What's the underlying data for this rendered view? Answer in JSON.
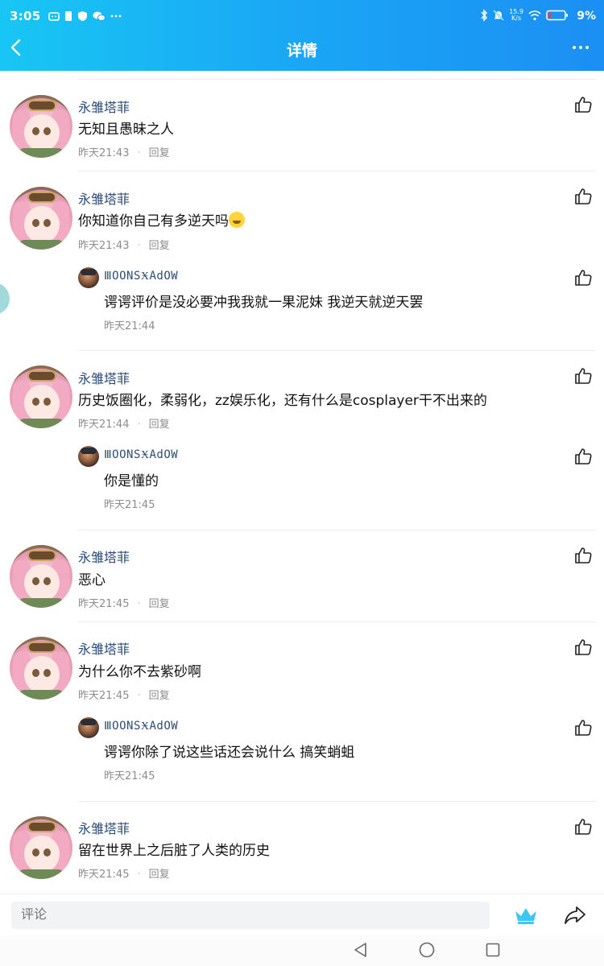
{
  "status": {
    "time": "3:05",
    "net_speed_value": "15.9",
    "net_speed_unit": "K/s",
    "battery": "9%"
  },
  "header": {
    "title": "详情"
  },
  "comments": [
    {
      "name": "永雏塔菲",
      "text": "无知且愚昧之人",
      "time": "昨天21:43",
      "reply": "回复"
    },
    {
      "name": "永雏塔菲",
      "text": "你知道你自己有多逆天吗",
      "time": "昨天21:43",
      "reply": "回复"
    },
    {
      "name": "ⅢOONSӾAdOW",
      "text": "谔谔评价是没必要冲我我就一果泥妹  我逆天就逆天罢",
      "time": "昨天21:44"
    },
    {
      "name": "永雏塔菲",
      "text": "历史饭圈化，柔弱化，zz娱乐化，还有什么是cosplayer干不出来的",
      "time": "昨天21:44",
      "reply": "回复"
    },
    {
      "name": "ⅢOONSӾAdOW",
      "text": "你是懂的",
      "time": "昨天21:45"
    },
    {
      "name": "永雏塔菲",
      "text": "恶心",
      "time": "昨天21:45",
      "reply": "回复"
    },
    {
      "name": "永雏塔菲",
      "text": "为什么你不去紫砂啊",
      "time": "昨天21:45",
      "reply": "回复"
    },
    {
      "name": "ⅢOONSӾAdOW",
      "text": "谔谔你除了说这些话还会说什么  搞笑蛸蛆",
      "time": "昨天21:45"
    },
    {
      "name": "永雏塔菲",
      "text": "留在世界上之后脏了人类的历史",
      "time": "昨天21:45",
      "reply": "回复"
    }
  ],
  "bottom": {
    "comment_placeholder": "评论"
  },
  "colors": {
    "header_start": "#18c6f4",
    "header_end": "#1b8ff4",
    "name": "#2c4d78",
    "meta": "#8c8c8c"
  },
  "icons": [
    "back-arrow-icon",
    "more-dots-icon",
    "thumbs-up-icon",
    "crown-icon",
    "share-icon",
    "nav-back-icon",
    "nav-home-icon",
    "nav-recents-icon"
  ]
}
